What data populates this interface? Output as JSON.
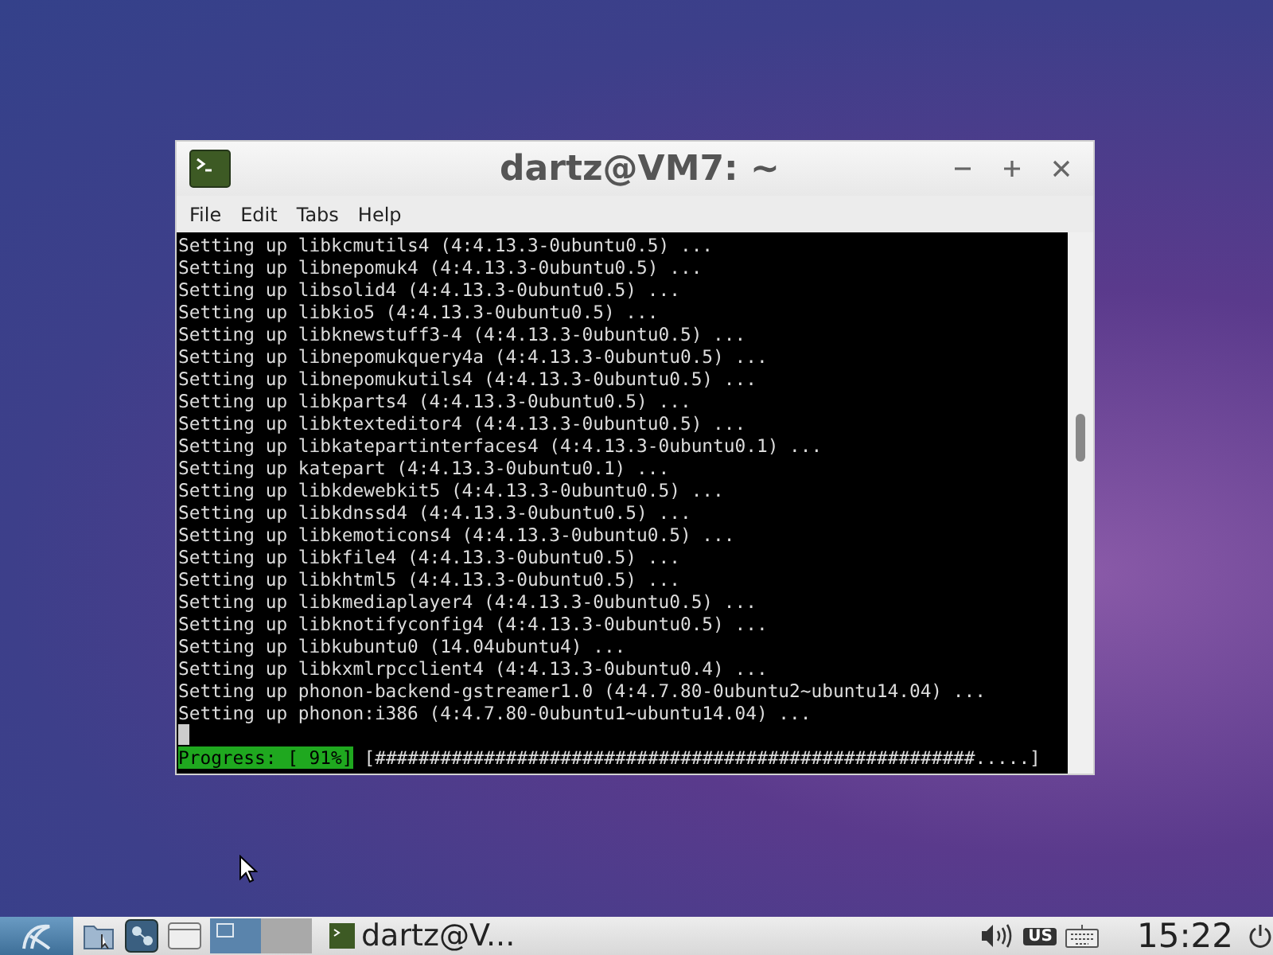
{
  "window": {
    "title": "dartz@VM7: ~"
  },
  "menu": [
    "File",
    "Edit",
    "Tabs",
    "Help"
  ],
  "terminal": {
    "lines": [
      "Setting up libkcmutils4 (4:4.13.3-0ubuntu0.5) ...",
      "Setting up libnepomuk4 (4:4.13.3-0ubuntu0.5) ...",
      "Setting up libsolid4 (4:4.13.3-0ubuntu0.5) ...",
      "Setting up libkio5 (4:4.13.3-0ubuntu0.5) ...",
      "Setting up libknewstuff3-4 (4:4.13.3-0ubuntu0.5) ...",
      "Setting up libnepomukquery4a (4:4.13.3-0ubuntu0.5) ...",
      "Setting up libnepomukutils4 (4:4.13.3-0ubuntu0.5) ...",
      "Setting up libkparts4 (4:4.13.3-0ubuntu0.5) ...",
      "Setting up libktexteditor4 (4:4.13.3-0ubuntu0.5) ...",
      "Setting up libkatepartinterfaces4 (4:4.13.3-0ubuntu0.1) ...",
      "Setting up katepart (4:4.13.3-0ubuntu0.1) ...",
      "Setting up libkdewebkit5 (4:4.13.3-0ubuntu0.5) ...",
      "Setting up libkdnssd4 (4:4.13.3-0ubuntu0.5) ...",
      "Setting up libkemoticons4 (4:4.13.3-0ubuntu0.5) ...",
      "Setting up libkfile4 (4:4.13.3-0ubuntu0.5) ...",
      "Setting up libkhtml5 (4:4.13.3-0ubuntu0.5) ...",
      "Setting up libkmediaplayer4 (4:4.13.3-0ubuntu0.5) ...",
      "Setting up libknotifyconfig4 (4:4.13.3-0ubuntu0.5) ...",
      "Setting up libkubuntu0 (14.04ubuntu4) ...",
      "Setting up libkxmlrpcclient4 (4:4.13.3-0ubuntu0.4) ...",
      "Setting up phonon-backend-gstreamer1.0 (4:4.7.80-0ubuntu2~ubuntu14.04) ...",
      "Setting up phonon:i386 (4:4.7.80-0ubuntu1~ubuntu14.04) ..."
    ],
    "progress_label": "Progress: [ 91%]",
    "progress_bar": "[#######################################################.....]"
  },
  "taskbar": {
    "task": "dartz@V...",
    "clock": "15:22",
    "keyboard_layout": "US"
  }
}
